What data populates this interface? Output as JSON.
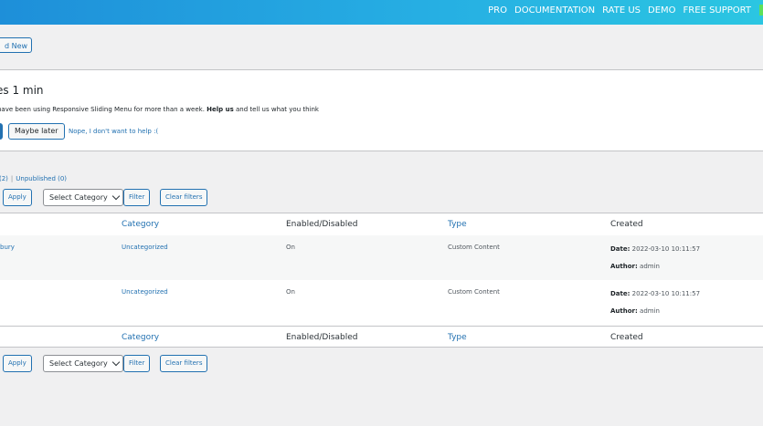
{
  "topbar": {
    "nav": [
      "PRO",
      "DOCUMENTATION",
      "RATE US",
      "DEMO",
      "FREE SUPPORT"
    ],
    "accent": "#5ee05a"
  },
  "add_new_label": "d New",
  "notice": {
    "title": "es 1 min",
    "text_prefix": "have been using Responsive Sliding Menu for more than a week. ",
    "text_bold": "Help us",
    "text_suffix": " and tell us what you think",
    "maybe_later": "Maybe later",
    "nope": "Nope, I don't want to help :("
  },
  "subsubsub": {
    "published": "(2)",
    "separator": "|",
    "unpublished": "Unpublished (0)"
  },
  "filters": {
    "apply": "Apply",
    "select_category": "Select Category",
    "filter": "Filter",
    "clear_filters": "Clear filters"
  },
  "table": {
    "columns": [
      "Category",
      "Enabled/Disabled",
      "Type",
      "Created"
    ],
    "rows": [
      {
        "title": "bury",
        "category": "Uncategorized",
        "status": "On",
        "type": "Custom Content",
        "date_label": "Date:",
        "date": "2022-03-10 10:11:57",
        "author_label": "Author:",
        "author": "admin"
      },
      {
        "title": "",
        "category": "Uncategorized",
        "status": "On",
        "type": "Custom Content",
        "date_label": "Date:",
        "date": "2022-03-10 10:11:57",
        "author_label": "Author:",
        "author": "admin"
      }
    ]
  }
}
